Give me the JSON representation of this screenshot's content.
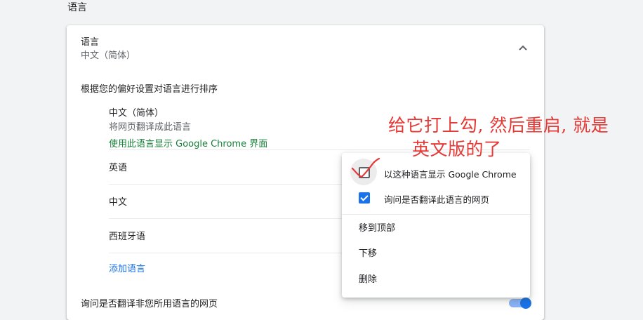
{
  "section": {
    "title": "语言"
  },
  "language_card": {
    "header_title": "语言",
    "header_subtitle": "中文（简体）",
    "order_description": "根据您的偏好设置对语言进行排序",
    "languages": [
      {
        "name": "中文（简体）",
        "note": "将网页翻译成此语言",
        "display_note": "使用此语言显示 Google Chrome 界面"
      },
      {
        "name": "英语"
      },
      {
        "name": "中文"
      },
      {
        "name": "西班牙语"
      }
    ],
    "add_language": "添加语言",
    "translate_offer_label": "询问是否翻译非您所用语言的网页",
    "translate_offer_enabled": true
  },
  "context_menu": {
    "display_in_language": {
      "label": "以这种语言显示 Google Chrome",
      "checked": false
    },
    "offer_translate": {
      "label": "询问是否翻译此语言的网页",
      "checked": true
    },
    "items": [
      "移到顶部",
      "下移",
      "删除"
    ]
  },
  "annotation": {
    "line1": "给它打上勾, 然后重启, 就是",
    "line2": "英文版的了",
    "color": "#e53935"
  },
  "colors": {
    "accent": "#1a73e8",
    "green_link": "#188038",
    "background": "#f1f3f4"
  }
}
